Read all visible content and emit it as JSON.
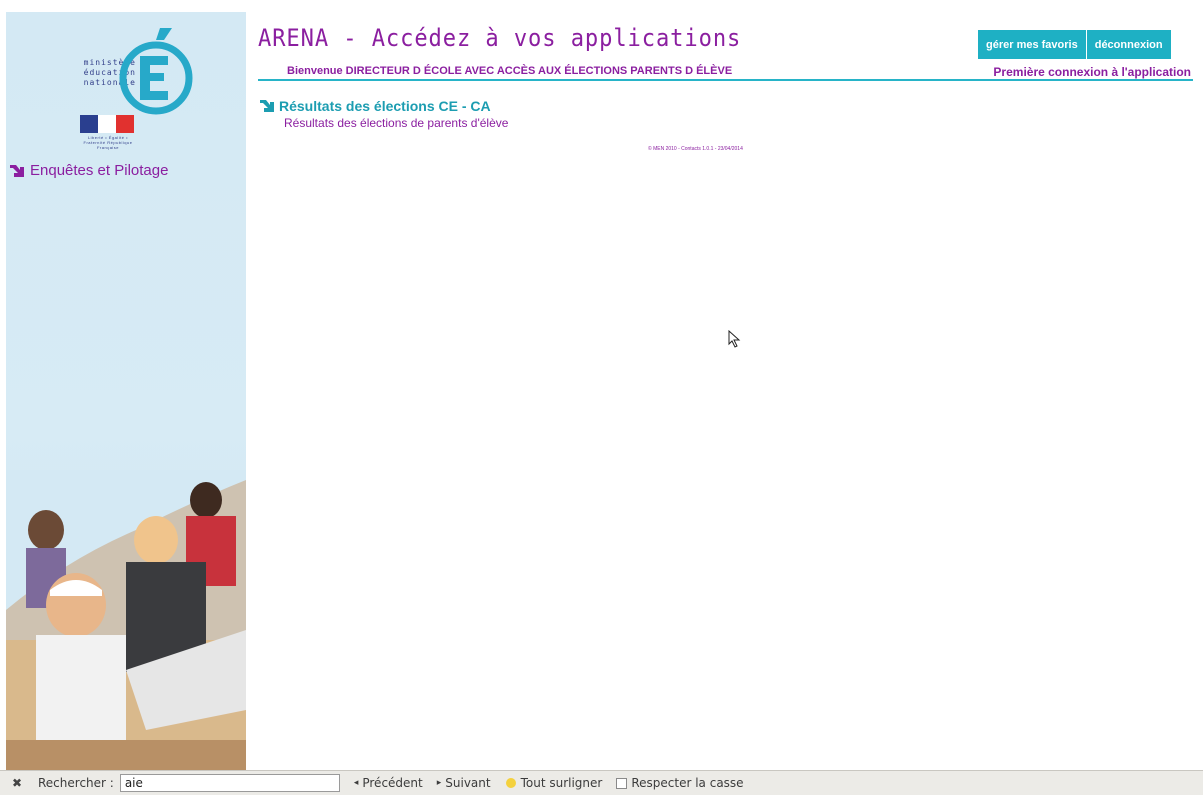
{
  "sidebar": {
    "logo_text": [
      "ministère",
      "éducation",
      "nationale"
    ],
    "logo_letter": "É",
    "flag_subtitle": "Liberté • Égalité • Fraternité\nRépublique Française",
    "nav_link": "Enquêtes et Pilotage"
  },
  "header": {
    "app_title": "ARENA - Accédez à vos applications",
    "welcome": "Bienvenue DIRECTEUR D ÉCOLE AVEC ACCÈS AUX ÉLECTIONS PARENTS D ÉLÈVE",
    "favorites_button": "gérer mes favoris",
    "logout_button": "déconnexion",
    "first_connection": "Première connexion à l'application"
  },
  "content": {
    "result_title": "Résultats des élections CE - CA",
    "result_subtitle": "Résultats des élections de parents d'élève",
    "footer_note": "© MEN 2010 - Contacts 1.0.1 - 23/04/2014"
  },
  "findbar": {
    "search_label": "Rechercher :",
    "search_value": "aie",
    "previous": "Précédent",
    "next": "Suivant",
    "highlight_all": "Tout surligner",
    "match_case": "Respecter la casse"
  },
  "colors": {
    "brand_purple": "#8b1fa0",
    "accent_teal": "#1eb0c4",
    "sidebar_bg": "#d4e9f4"
  }
}
